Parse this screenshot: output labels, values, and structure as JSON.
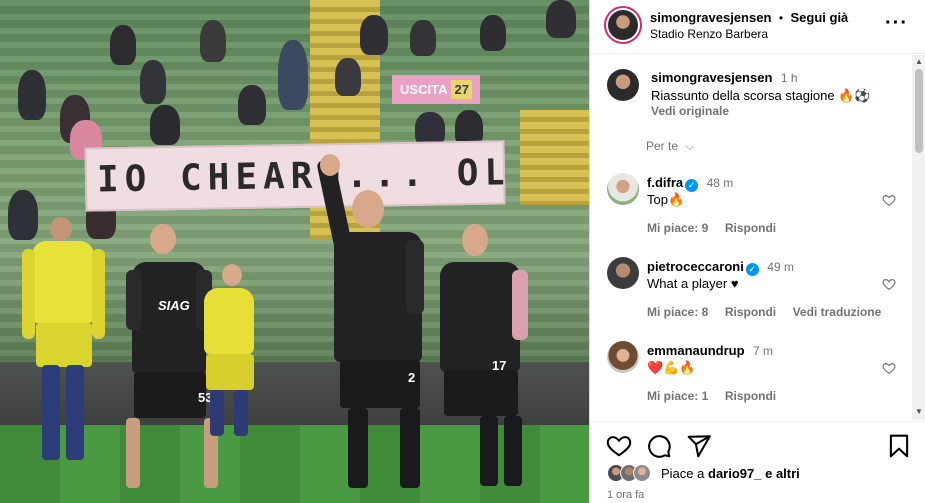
{
  "post": {
    "author": "simongravesjensen",
    "separator": "•",
    "follow_label": "Segui già",
    "location": "Stadio Renzo Barbera",
    "more_label": "•••"
  },
  "photo": {
    "banner_text": "IO CHEARO... OLO TE",
    "sign_text": "USCITA",
    "sign_number": "27",
    "sponsor_text": "SIAG",
    "shirt_numbers": [
      "53",
      "2",
      "17"
    ]
  },
  "caption": {
    "author": "simongravesjensen",
    "time": "1 h",
    "text": "Riassunto della scorsa stagione 🔥⚽",
    "see_original": "Vedi originale"
  },
  "filter": {
    "label": "Per te"
  },
  "comments": [
    {
      "user": "f.difra",
      "verified": true,
      "time": "48 m",
      "text": "Top🔥",
      "likes": "Mi piace: 9",
      "reply": "Rispondi",
      "translate": ""
    },
    {
      "user": "pietroceccaroni",
      "verified": true,
      "time": "49 m",
      "text": "What a player ♥",
      "likes": "Mi piace: 8",
      "reply": "Rispondi",
      "translate": "Vedi traduzione"
    },
    {
      "user": "emmanaundrup",
      "verified": false,
      "time": "7 m",
      "text": "❤️💪🔥",
      "likes": "Mi piace: 1",
      "reply": "Rispondi",
      "translate": ""
    }
  ],
  "footer": {
    "likes_prefix": "Piace a",
    "likes_user": "dario97_",
    "likes_suffix": "e altri",
    "time": "1 ora fa"
  },
  "colors": {
    "accent": "#0095f6",
    "ring": "#d62976",
    "muted": "#737373"
  }
}
